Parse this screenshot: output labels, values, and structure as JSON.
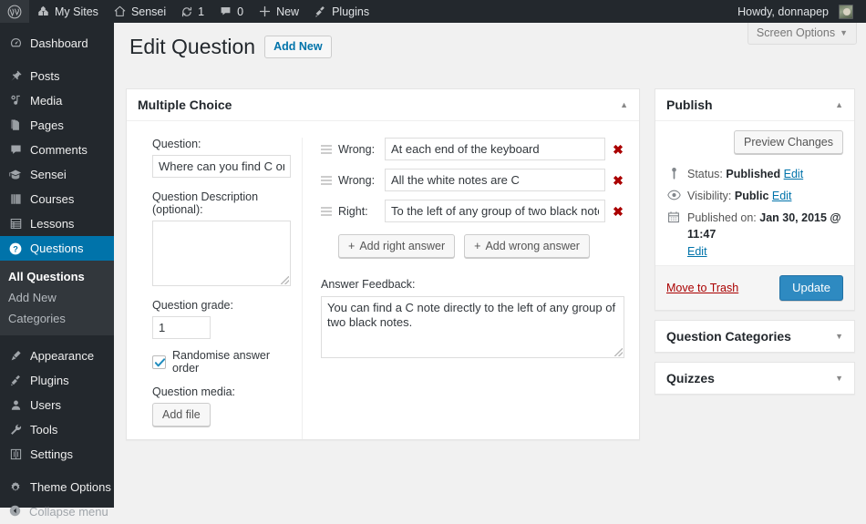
{
  "adminbar": {
    "logo_icon": "wordpress-logo-icon",
    "items": [
      {
        "label": "My Sites",
        "icon": "my-sites-icon"
      },
      {
        "label": "Sensei",
        "icon": "site-home-icon"
      },
      {
        "label": "1",
        "icon": "updates-icon"
      },
      {
        "label": "0",
        "icon": "comment-bubble-icon"
      },
      {
        "label": "New",
        "icon": "plus-icon"
      },
      {
        "label": "Plugins",
        "icon": "plugins-icon"
      }
    ],
    "howdy": "Howdy, donnapep"
  },
  "sidebar": {
    "items": [
      {
        "label": "Dashboard",
        "icon": "dashboard-icon",
        "current": false
      },
      {
        "label": "Posts",
        "icon": "pin-icon",
        "current": false
      },
      {
        "label": "Media",
        "icon": "media-icon",
        "current": false
      },
      {
        "label": "Pages",
        "icon": "pages-icon",
        "current": false
      },
      {
        "label": "Comments",
        "icon": "comments-icon",
        "current": false
      },
      {
        "label": "Sensei",
        "icon": "graduation-cap-icon",
        "current": false
      },
      {
        "label": "Courses",
        "icon": "book-icon",
        "current": false
      },
      {
        "label": "Lessons",
        "icon": "lessons-grid-icon",
        "current": false
      },
      {
        "label": "Questions",
        "icon": "question-mark-icon",
        "current": true
      },
      {
        "label": "Appearance",
        "icon": "appearance-brush-icon",
        "current": false
      },
      {
        "label": "Plugins",
        "icon": "plugins-icon",
        "current": false
      },
      {
        "label": "Users",
        "icon": "users-icon",
        "current": false
      },
      {
        "label": "Tools",
        "icon": "tools-wrench-icon",
        "current": false
      },
      {
        "label": "Settings",
        "icon": "settings-sliders-icon",
        "current": false
      },
      {
        "label": "Theme Options",
        "icon": "gear-icon",
        "current": false
      }
    ],
    "submenu": [
      {
        "label": "All Questions",
        "current": true
      },
      {
        "label": "Add New",
        "current": false
      },
      {
        "label": "Categories",
        "current": false
      }
    ],
    "collapse": {
      "label": "Collapse menu",
      "icon": "collapse-arrow-icon"
    }
  },
  "screen_options": {
    "label": "Screen Options",
    "caret": "▼"
  },
  "page": {
    "title": "Edit Question",
    "add_new_label": "Add New"
  },
  "question_box": {
    "title": "Multiple Choice",
    "toggle": "▲",
    "question_label": "Question:",
    "question_value": "Where can you find C on the keyboard?",
    "description_label": "Question Description (optional):",
    "description_value": "",
    "grade_label": "Question grade:",
    "grade_value": "1",
    "randomise_label": "Randomise answer order",
    "randomise_checked": true,
    "media_label": "Question media:",
    "add_file_label": "Add file",
    "answers": [
      {
        "type": "Wrong:",
        "value": "At each end of the keyboard",
        "delete_icon": "delete-x-icon",
        "handle_icon": "drag-handle-icon"
      },
      {
        "type": "Wrong:",
        "value": "All the white notes are C",
        "delete_icon": "delete-x-icon",
        "handle_icon": "drag-handle-icon"
      },
      {
        "type": "Right:",
        "value": "To the left of any group of two black notes",
        "delete_icon": "delete-x-icon",
        "handle_icon": "drag-handle-icon"
      }
    ],
    "add_right_label": "Add right answer",
    "add_wrong_label": "Add wrong answer",
    "feedback_label": "Answer Feedback:",
    "feedback_value": "You can find a C note directly to the left of any group of two black notes."
  },
  "publish": {
    "title": "Publish",
    "toggle": "▲",
    "preview_label": "Preview Changes",
    "status_label": "Status:",
    "status_value": "Published",
    "status_edit": "Edit",
    "status_icon": "post-status-pin-icon",
    "visibility_label": "Visibility:",
    "visibility_value": "Public",
    "visibility_edit": "Edit",
    "visibility_icon": "eye-icon",
    "published_label": "Published on:",
    "published_value": "Jan 30, 2015 @ 11:47",
    "published_edit": "Edit",
    "published_icon": "calendar-icon",
    "trash_label": "Move to Trash",
    "update_label": "Update"
  },
  "side_boxes": [
    {
      "title": "Question Categories",
      "toggle": "▼"
    },
    {
      "title": "Quizzes",
      "toggle": "▼"
    }
  ],
  "colors": {
    "admin_bar": "#23282d",
    "sidebar": "#23282d",
    "accent_blue": "#0073aa",
    "button_blue": "#2e8ac1",
    "delete_red": "#a00",
    "content_bg": "#f1f1f1"
  }
}
